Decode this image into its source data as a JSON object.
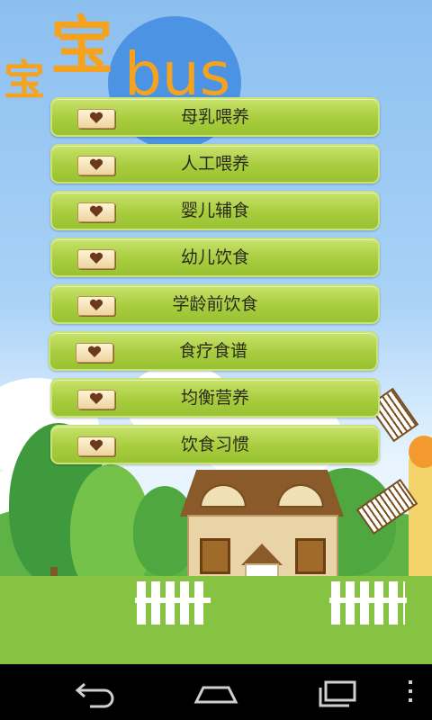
{
  "logo": {
    "char_small": "宝",
    "char_large": "宝",
    "word": "bus"
  },
  "menu": {
    "items": [
      {
        "label": "母乳喂养"
      },
      {
        "label": "人工喂养"
      },
      {
        "label": "婴儿辅食"
      },
      {
        "label": "幼儿饮食"
      },
      {
        "label": "学龄前饮食"
      },
      {
        "label": "食疗食谱"
      },
      {
        "label": "均衡营养"
      },
      {
        "label": "饮食习惯"
      }
    ],
    "icon": "heart-card-icon"
  },
  "navbar": {
    "buttons": [
      "back-icon",
      "home-icon",
      "recent-apps-icon",
      "overflow-menu-icon"
    ]
  },
  "colors": {
    "sky": "#8cbff0",
    "logo_orange": "#f5a21e",
    "sun_blue": "#4c93e3",
    "button_green": "#a8cd3e",
    "grass": "#86c342"
  }
}
